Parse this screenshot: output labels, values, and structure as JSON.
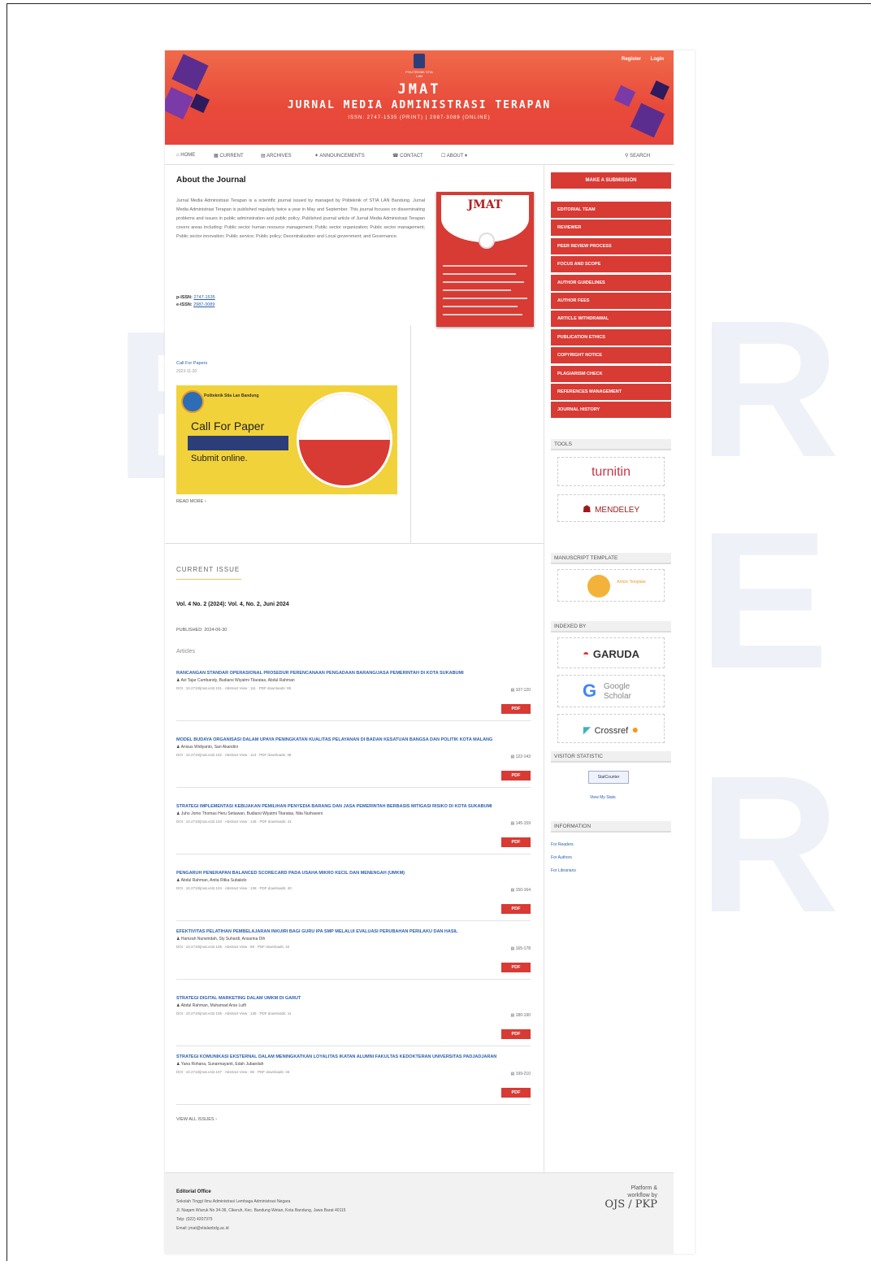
{
  "header": {
    "journal_short": "JMAT",
    "journal_full": "JURNAL MEDIA ADMINISTRASI TERAPAN",
    "issn_line": "ISSN: 2747-1535 (PRINT) | 2987-3089 (ONLINE)",
    "logo_caption": "POLITEKNIK STIA LAN",
    "register": "Register",
    "login": "Login"
  },
  "nav": {
    "home": "⌂ HOME",
    "current": "▦ CURRENT",
    "archives": "▤ ARCHIVES",
    "announcements": "✦ ANNOUNCEMENTS",
    "contact": "☎ CONTACT",
    "about": "☐ ABOUT ▾",
    "search": "⚲ SEARCH"
  },
  "about": {
    "heading": "About the Journal",
    "text": "Jurnal Media Administrasi Terapan is a scientific journal issued by managed by Politeknik of STIA LAN Bandung. Jurnal Media Administrasi Terapan is published regularly twice a year in May and September. This journal focuses on disseminating problems and issues in public administration and public policy. Published journal article of Jurnal Media Administrasi Terapan covers areas including: Public sector human resource management; Public sector organization; Public sector management; Public sector innovation; Public service; Public policy; Decentralization and Local government; and Governance.",
    "pissn_label": "p-ISSN:",
    "pissn": "2747-1535",
    "eissn_label": "e-ISSN:",
    "eissn": "2987-3089",
    "cover_title": "JMAT"
  },
  "announcement": {
    "title": "Call For Papers",
    "date": "2023-11-20",
    "image_heading": "Call For Paper",
    "image_sub": "Submit online.",
    "image_org": "Politeknik Stia Lan Bandung",
    "read_more": "READ MORE ›"
  },
  "current_issue": {
    "label": "CURRENT ISSUE",
    "volume": "Vol. 4 No. 2 (2024): Vol. 4, No. 2, Juni 2024",
    "published": "PUBLISHED: 2024-06-30",
    "articles_label": "Articles",
    "view_all": "VIEW ALL ISSUES ›",
    "pdf_label": "PDF",
    "articles": [
      {
        "title": "RANCANGAN STANDAR OPERASIONAL PROSEDUR PERENCANAAN PENGADAAN BARANG/JASA PEMERINTAH DI KOTA SUKABUMI",
        "authors": "♟ Avi Tajar Cumbandy, Budiarsi Wiyatmi Tilaratas, Abdul Rahman",
        "meta": "DOI : 10.2710/jmat.v4i2.101 · Abstract View : 111 · PDF downloads: 85",
        "pages": "▤ 107-120"
      },
      {
        "title": "MODEL BUDAYA ORGANISASI DALAM UPAYA PENINGKATAN KUALITAS PELAYANAN DI BADAN KESATUAN BANGSA DAN POLITIK KOTA MALANG",
        "authors": "♟ Anisus Widiyanto, Sari Akandini",
        "meta": "DOI : 10.2710/jmat.v4i2.102 · Abstract View : 113 · PDF downloads: 38",
        "pages": "▤ 122-143"
      },
      {
        "title": "STRATEGI IMPLEMENTASI KEBIJAKAN PEMILIHAN PENYEDIA BARANG DAN JASA PEMERINTAH BERBASIS MITIGASI RISIKO DI KOTA SUKABUMI",
        "authors": "♟ Juho Jomo Thomas Heru Setiawan, Budiarsi Wiyatmi Tilaratas, Nita Nurhaveni",
        "meta": "DOI : 10.2710/jmat.v4i2.103 · Abstract View : 145 · PDF downloads: 41",
        "pages": "▤ 145-159"
      },
      {
        "title": "PENGARUH PENERAPAN BALANCED SCORECARD PADA USAHA MIKRO KECIL DAN MENENGAH (UMKM)",
        "authors": "♟ Abdul Rahman, Anita Ritka Subakdo",
        "meta": "DOI : 10.2710/jmat.v4i2.104 · Abstract View : 138 · PDF downloads: 40",
        "pages": "▤ 150-164"
      },
      {
        "title": "EFEKTIVITAS PELATIHAN PEMBELAJARAN INKUIRI BAGI GURU IPA SMP MELALUI EVALUASI PERUBAHAN PERILAKU DAN HASIL",
        "authors": "♟ Hamzah Nurwindah, Sly Suhardi, Ansarina Dih",
        "meta": "DOI : 10.2710/jmat.v4i2.105 · Abstract View : 89 · PDF downloads: 42",
        "pages": "▤ 165-178"
      },
      {
        "title": "STRATEGI DIGITAL MARKETING DALAM UMKM DI GARUT",
        "authors": "♟ Abdul Rahman, Muhamad Aras Lutfi",
        "meta": "DOI : 10.2710/jmat.v4i2.106 · Abstract View : 135 · PDF downloads: 11",
        "pages": "▤ 180-190"
      },
      {
        "title": "STRATEGI KOMUNIKASI EKSTERNAL DALAM MENINGKATKAN LOYALITAS IKATAN ALUMNI FAKULTAS KEDOKTERAN UNIVERSITAS PADJADJARAN",
        "authors": "♟ Yana Rohana, Sunarmayanti, Edah Jubaedah",
        "meta": "DOI : 10.2710/jmat.v4i2.107 · Abstract View : 86 · PDF downloads: 45",
        "pages": "▤ 199-210"
      }
    ]
  },
  "sidebar": {
    "submit": "MAKE A SUBMISSION",
    "menu": [
      "EDITORIAL TEAM",
      "REVIEWER",
      "PEER REVIEW PROCESS",
      "FOCUS AND SCOPE",
      "AUTHOR GUIDELINES",
      "AUTHOR FEES",
      "ARTICLE WITHDRAWAL",
      "PUBLICATION ETHICS",
      "COPYRIGHT NOTICE",
      "PLAGIARISM CHECK",
      "REFERENCES MANAGEMENT",
      "JOURNAL HISTORY"
    ],
    "tools_heading": "TOOLS",
    "turnitin": "turnitin",
    "mendeley": "MENDELEY",
    "template_heading": "MANUSCRIPT TEMPLATE",
    "template_label": "Article Template",
    "indexed_heading": "INDEXED BY",
    "garuda": "GARUDA",
    "google1": "Google",
    "google2": "Scholar",
    "crossref": "Crossref",
    "visitor_heading": "VISITOR STATISTIC",
    "statcounter": "StatCounter",
    "view_stats": "View My Stats",
    "information_heading": "INFORMATION",
    "info_links": [
      "For Readers",
      "For Authors",
      "For Librarians"
    ]
  },
  "footer": {
    "heading": "Editorial Office",
    "line1": "Sekolah Tinggi Ilmu Administrasi Lembaga Administrasi Negara",
    "line2": "Jl. Naqam Wiuruk No 34-36, Cikeruh, Kec. Bandung Wetan, Kota Bandung, Jawa Barat 40115",
    "line3": "Telp: (022) 4207375",
    "line4": "Email: jmat@stialanbdg.ac.id",
    "platform": "Platform &",
    "workflow": "workflow by",
    "ojs": "OJS / PKP"
  }
}
